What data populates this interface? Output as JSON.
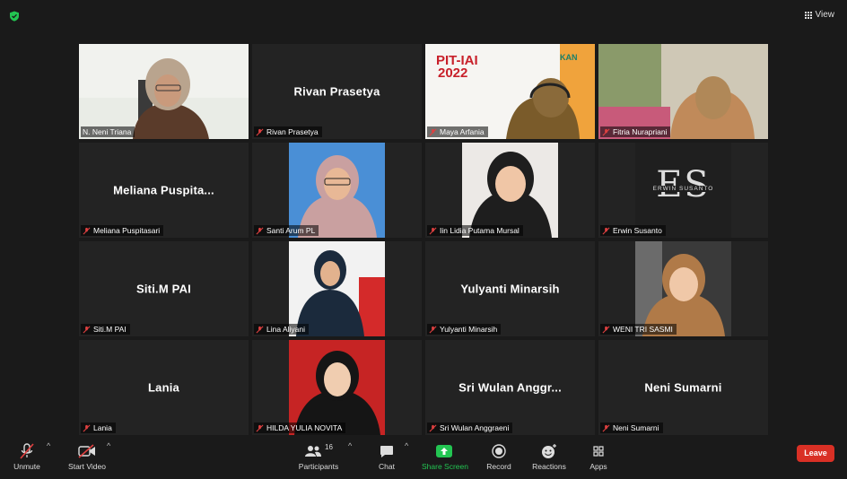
{
  "header": {
    "view_label": "View"
  },
  "tiles": [
    {
      "name": "N. Neni Triana",
      "display": "",
      "video": true
    },
    {
      "name": "Rivan Prasetya",
      "display": "Rivan Prasetya",
      "video": false
    },
    {
      "name": "Maya Arfania",
      "display": "",
      "video": true
    },
    {
      "name": "Fitria Nurapriani",
      "display": "",
      "video": true
    },
    {
      "name": "Meliana Puspitasari",
      "display": "Meliana Puspita...",
      "video": false
    },
    {
      "name": "Santi Arum PL",
      "display": "",
      "video": true
    },
    {
      "name": "Iin Lidia Putama Mursal",
      "display": "",
      "video": true
    },
    {
      "name": "Erwin Susanto",
      "display": "",
      "video": true
    },
    {
      "name": "Siti.M  PAI",
      "display": "Siti.M  PAI",
      "video": false
    },
    {
      "name": "Lina Aliyani",
      "display": "",
      "video": true
    },
    {
      "name": "Yulyanti Minarsih",
      "display": "Yulyanti Minarsih",
      "video": false
    },
    {
      "name": "WENI TRI SASMI",
      "display": "",
      "video": true
    },
    {
      "name": "Lania",
      "display": "Lania",
      "video": false
    },
    {
      "name": "HILDA YULIA NOVITA",
      "display": "",
      "video": true
    },
    {
      "name": "Sri Wulan Anggraeni",
      "display": "Sri Wulan Anggr...",
      "video": false
    },
    {
      "name": "Neni Sumarni",
      "display": "Neni Sumarni",
      "video": false
    }
  ],
  "slide": {
    "title": "PIT-IAI",
    "year": "2022",
    "brand": "KAN"
  },
  "logo_text": {
    "letters": "ES",
    "subtitle": "ERWIN SUSANTO"
  },
  "toolbar": {
    "unmute": "Unmute",
    "start_video": "Start Video",
    "participants": "Participants",
    "participants_count": "16",
    "chat": "Chat",
    "share_screen": "Share Screen",
    "record": "Record",
    "reactions": "Reactions",
    "apps": "Apps",
    "leave": "Leave"
  },
  "colors": {
    "share_green": "#23c552",
    "leave_red": "#d93025",
    "active_speaker": "#e2e06a"
  }
}
